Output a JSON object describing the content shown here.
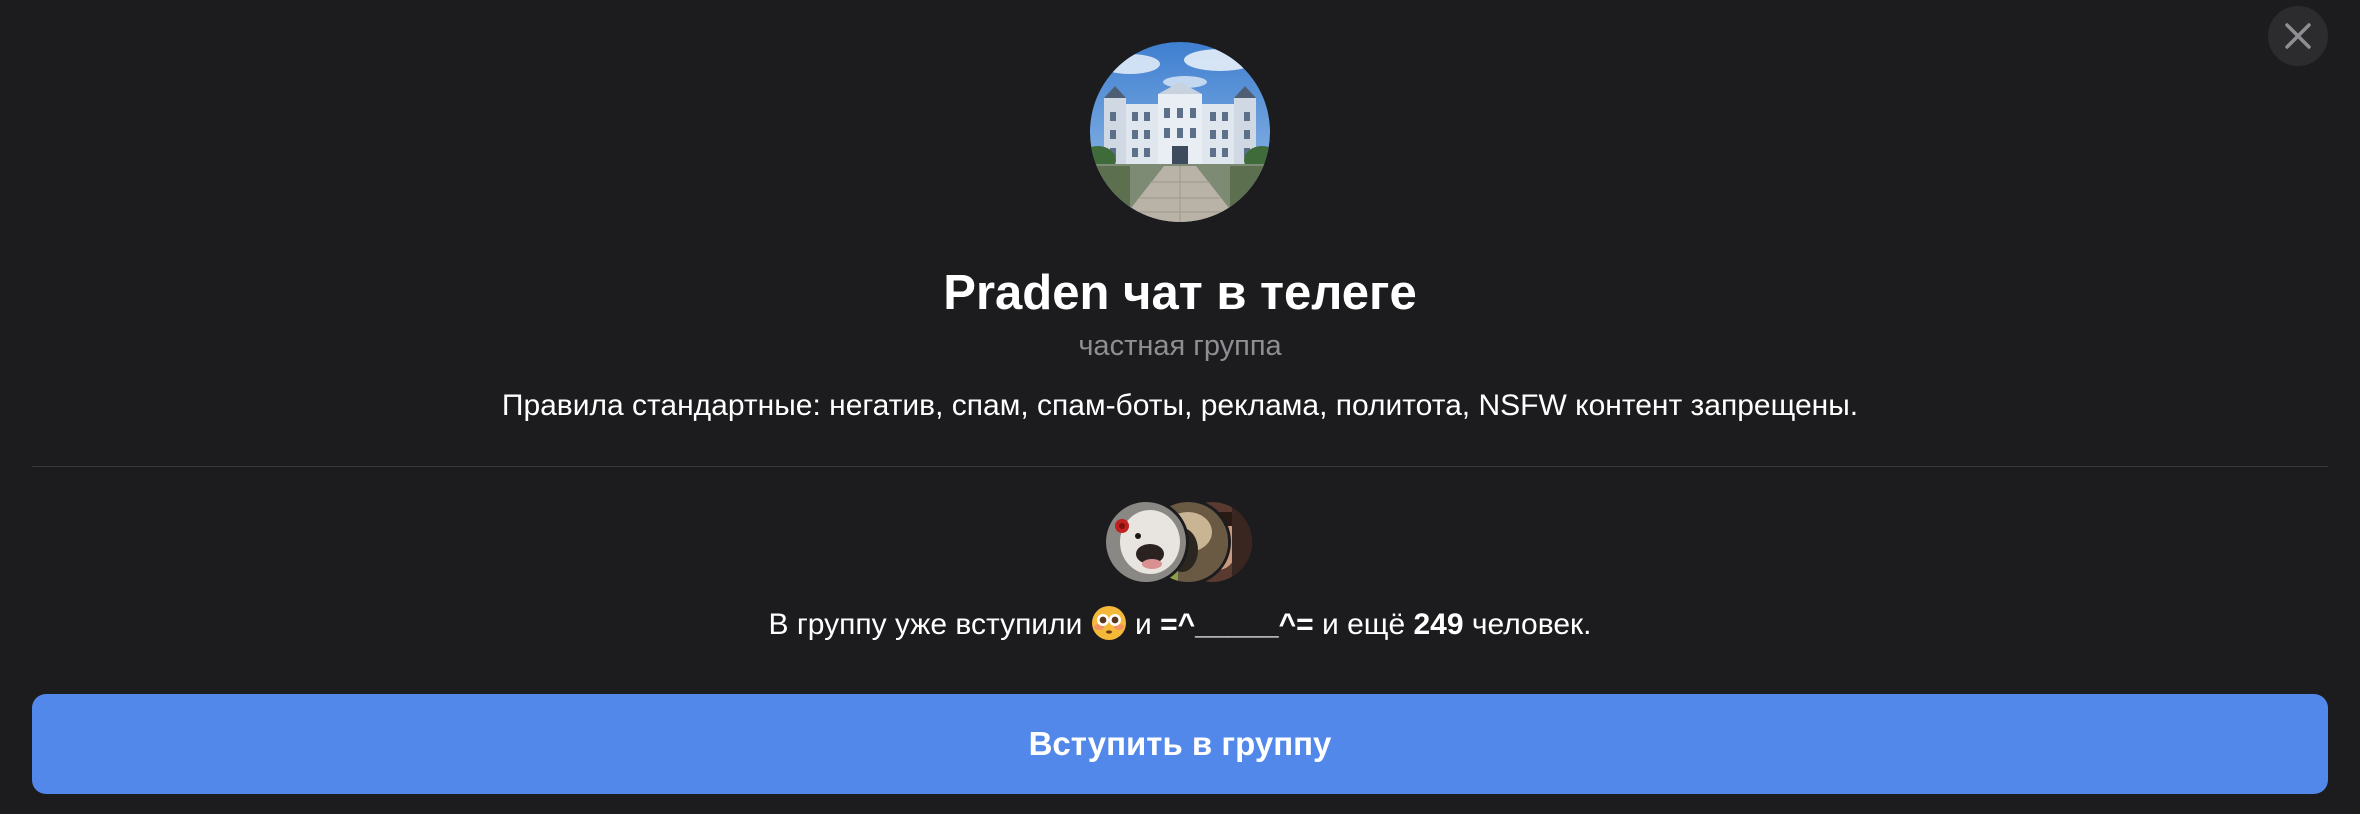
{
  "dialog": {
    "close_icon": "close-icon",
    "group": {
      "avatar_icon": "group-photo-building",
      "title": "Praden чат в телеге",
      "type": "частная группа",
      "description": "Правила стандартные: негатив, спам, спам-боты, реклама, политота, NSFW контент запрещены."
    },
    "members": {
      "prefix": "В группу уже вступили",
      "first_member_emoji": "😳",
      "joiner": "и",
      "second_member": "=^_____^=",
      "and_more": "и ещё",
      "count": "249",
      "suffix": "человек."
    },
    "join_button": {
      "label": "Вступить в группу",
      "color": "#5288ea"
    }
  },
  "colors": {
    "background": "#1c1c1e",
    "secondary_text": "#8e8e93",
    "divider": "#38383a"
  }
}
